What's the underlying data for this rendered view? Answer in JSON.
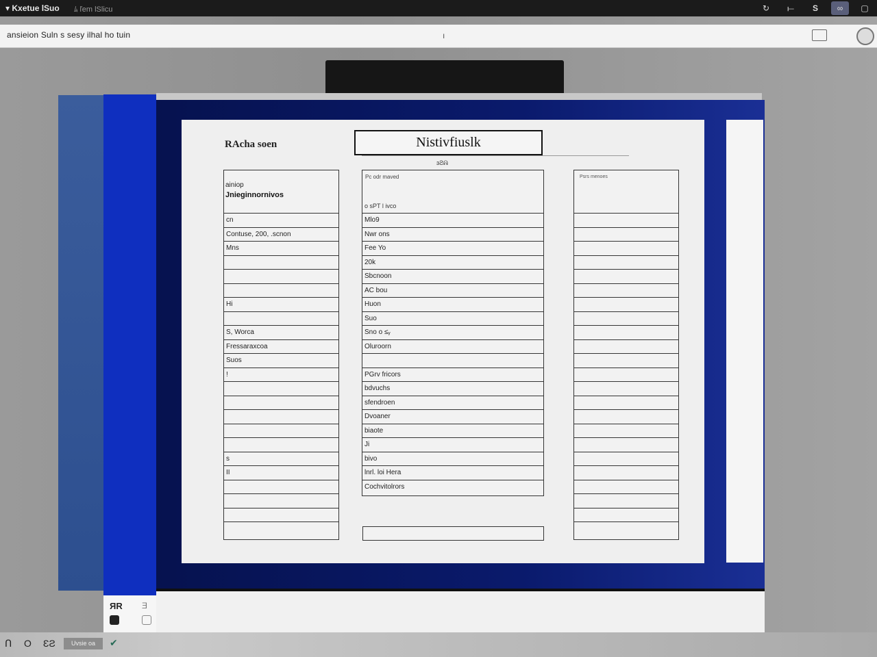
{
  "titlebar": {
    "app_name": "▾ Kxetue lSuo",
    "tab": "ﾑ ľem lSlicu",
    "icons": [
      "refresh-icon",
      "pin-icon",
      "s-icon",
      "glasses-icon"
    ]
  },
  "toolbar": {
    "address": "ansieion  Suln   s sesy  ilhal  ho  tuin",
    "caret": "ı"
  },
  "document": {
    "header": "RAcha soen",
    "title": "Nistivfiuslk",
    "subtitle": "ɜƧᕱ",
    "col1": {
      "head_line1": "ainiop",
      "head_line2": "Jnieginnornivos",
      "rows": [
        "cn",
        "Contuse, 200, .scnon",
        "Mns",
        "",
        "",
        "",
        "Hi",
        "",
        "S, Worca",
        "Fressaraxcoa",
        "Suos",
        "!",
        "",
        "",
        "",
        "",
        "",
        "s",
        "II",
        "",
        "",
        "",
        ""
      ]
    },
    "col2": {
      "head_line1": "Pc odr maved",
      "head_line2": "o sPT l ivco",
      "rows": [
        "Mlo9",
        "Nwr ons",
        "Fee Yo",
        "20k",
        "Sbcnoon",
        "AC bou",
        "Huon",
        "Suo",
        "Sno o ≤ᵧ",
        "Oluroorn",
        "",
        "PGrv fricors",
        "bdvuchs",
        "sfendroen",
        "Dvoaner",
        "biaote",
        "Ji",
        "bivo",
        "lnrl. loi Hera",
        "Cochvitolrors"
      ]
    },
    "col3": {
      "head_line1": "Psrs menoes",
      "rows": [
        "",
        "",
        "",
        "",
        "",
        "",
        "",
        "",
        "",
        "",
        "",
        "",
        "",
        "",
        "",
        "",
        "",
        "",
        "",
        "",
        "",
        "",
        ""
      ]
    }
  },
  "side_bottom": {
    "label1": "ЯR",
    "label2": "Ǝ"
  },
  "taskbar": {
    "item1": "Ո",
    "item2": "O",
    "item3": "ƐƧ",
    "pill": "Uvsie oa",
    "check": "✔"
  }
}
